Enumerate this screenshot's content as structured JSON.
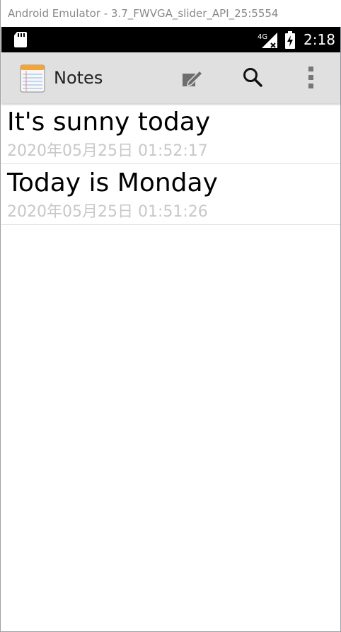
{
  "window": {
    "title": "Android Emulator - 3.7_FWVGA_slider_API_25:5554"
  },
  "status_bar": {
    "time": "2:18",
    "network_label": "4G",
    "icons": [
      "sd-card-icon",
      "signal-icon",
      "battery-charging-icon"
    ]
  },
  "action_bar": {
    "app_icon": "notepad-icon",
    "title": "Notes",
    "actions": [
      "new-note-icon",
      "search-icon",
      "overflow-menu-icon"
    ],
    "background": "#e0e0e0"
  },
  "notes": [
    {
      "title": "It's sunny today",
      "date": "2020年05月25日 01:52:17"
    },
    {
      "title": "Today is Monday",
      "date": "2020年05月25日 01:51:26"
    }
  ],
  "colors": {
    "date_text": "#c8c8c8",
    "status_bar": "#000000"
  }
}
